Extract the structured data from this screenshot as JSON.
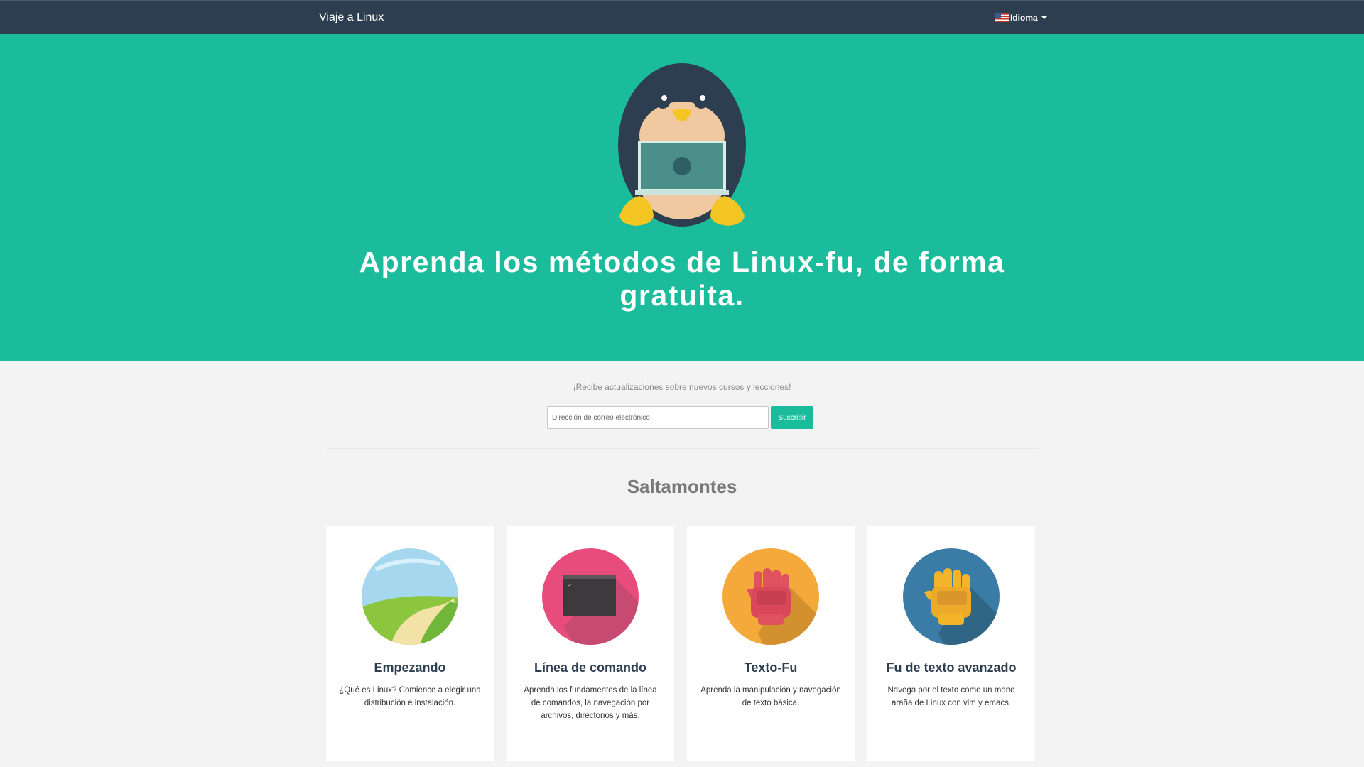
{
  "nav": {
    "brand": "Viaje a Linux",
    "language_label": "Idioma",
    "language_flag": "us-flag-icon"
  },
  "hero": {
    "mascot": "penguin-laptop-icon",
    "title": "Aprenda los métodos de Linux-fu, de forma gratuita.",
    "background": "#1abc9c"
  },
  "subscribe": {
    "prompt": "¡Recibe actualizaciones sobre nuevos cursos y lecciones!",
    "email_placeholder": "Dirección de correo electrónico",
    "button_label": "Suscribir"
  },
  "section": {
    "title": "Saltamontes"
  },
  "cards": [
    {
      "icon": "landscape-icon",
      "title": "Empezando",
      "description": "¿Qué es Linux? Comience a elegir una distribución e instalación.",
      "color": "#5fb0d5"
    },
    {
      "icon": "terminal-icon",
      "title": "Línea de comando",
      "description": "Aprenda los fundamentos de la línea de comandos, la navegación por archivos, directorios y más.",
      "color": "#e84c7d"
    },
    {
      "icon": "red-fist-icon",
      "title": "Texto-Fu",
      "description": "Aprenda la manipulación y navegación de texto básica.",
      "color": "#f4a93a"
    },
    {
      "icon": "yellow-fist-icon",
      "title": "Fu de texto avanzado",
      "description": "Navega por el texto como un mono araña de Linux con vim y emacs.",
      "color": "#3a7ca5"
    }
  ],
  "colors": {
    "navbar": "#2d3e50",
    "accent": "#1abc9c",
    "page_background": "#f3f3f3"
  }
}
